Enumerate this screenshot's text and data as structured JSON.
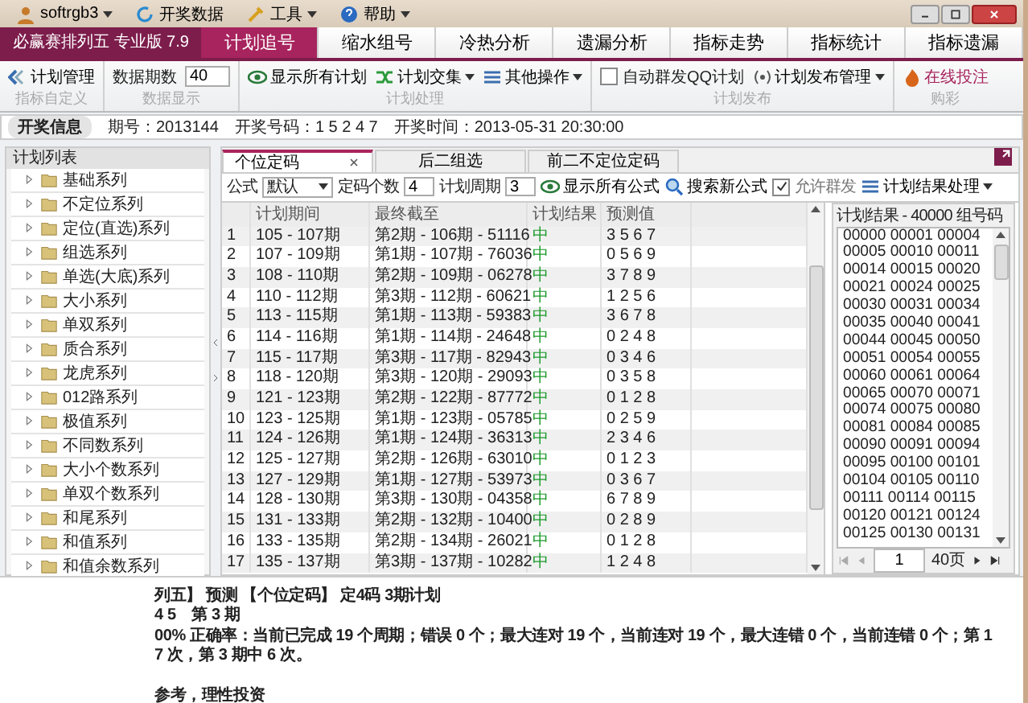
{
  "menu": [
    {
      "label": "softrgb3",
      "dropdown": true
    },
    {
      "label": "开奖数据",
      "dropdown": false
    },
    {
      "label": "工具",
      "dropdown": true
    },
    {
      "label": "帮助",
      "dropdown": true
    }
  ],
  "app_tab": "必赢赛排列五 专业版 7.9",
  "tabs": [
    {
      "label": "计划追号",
      "selected": true
    },
    {
      "label": "缩水组号",
      "selected": false
    },
    {
      "label": "冷热分析",
      "selected": false
    },
    {
      "label": "遗漏分析",
      "selected": false
    },
    {
      "label": "指标走势",
      "selected": false
    },
    {
      "label": "指标统计",
      "selected": false
    },
    {
      "label": "指标遗漏",
      "selected": false
    }
  ],
  "ribbon": [
    {
      "label": "指标自定义",
      "items": [
        {
          "kind": "button",
          "label": "计划管理"
        }
      ]
    },
    {
      "label": "数据显示",
      "items": [
        {
          "kind": "field",
          "label": "数据期数",
          "value": "40"
        }
      ]
    },
    {
      "label": "计划处理",
      "items": [
        {
          "kind": "button",
          "label": "显示所有计划"
        },
        {
          "kind": "dropdown",
          "label": "计划交集"
        },
        {
          "kind": "dropdown",
          "label": "其他操作"
        }
      ]
    },
    {
      "label": "计划发布",
      "items": [
        {
          "kind": "checkbox",
          "label": "自动群发QQ计划",
          "checked": false
        },
        {
          "kind": "dropdown",
          "label": "计划发布管理"
        }
      ]
    },
    {
      "label": "购彩",
      "items": [
        {
          "kind": "link",
          "label": "在线投注"
        }
      ]
    }
  ],
  "draw_info": {
    "title": "开奖信息",
    "issue": "期号：2013144",
    "numbers": "开奖号码：1 5 2 4 7",
    "time": "开奖时间：2013-05-31 20:30:00"
  },
  "sidebar": {
    "title": "计划列表",
    "items": [
      "基础系列",
      "不定位系列",
      "定位(直选)系列",
      "组选系列",
      "单选(大底)系列",
      "大小系列",
      "单双系列",
      "质合系列",
      "龙虎系列",
      "012路系列",
      "极值系列",
      "不同数系列",
      "大小个数系列",
      "单双个数系列",
      "和尾系列",
      "和值系列",
      "和值余数系列"
    ]
  },
  "doc_tabs": [
    {
      "label": "个位定码",
      "selected": true,
      "closable": true
    },
    {
      "label": "后二组选",
      "selected": false,
      "closable": false
    },
    {
      "label": "前二不定位定码",
      "selected": false,
      "closable": false
    }
  ],
  "toolbar": {
    "formula_label": "公式",
    "formula_value": "默认",
    "count_label": "定码个数",
    "count_value": "4",
    "period_label": "计划周期",
    "period_value": "3",
    "show_all": "显示所有公式",
    "search": "搜索新公式",
    "allow_group": {
      "label": "允许群发",
      "checked": true
    },
    "process": "计划结果处理"
  },
  "table": {
    "columns": [
      "计划期间",
      "最终截至",
      "计划结果",
      "预测值"
    ],
    "rows": [
      {
        "n": "1",
        "period": "105 - 107期",
        "end": "第2期 - 106期 - 51116",
        "result": "中",
        "pred": "3 5 6 7"
      },
      {
        "n": "2",
        "period": "107 - 109期",
        "end": "第1期 - 107期 - 76036",
        "result": "中",
        "pred": "0 5 6 9"
      },
      {
        "n": "3",
        "period": "108 - 110期",
        "end": "第2期 - 109期 - 06278",
        "result": "中",
        "pred": "3 7 8 9"
      },
      {
        "n": "4",
        "period": "110 - 112期",
        "end": "第3期 - 112期 - 60621",
        "result": "中",
        "pred": "1 2 5 6"
      },
      {
        "n": "5",
        "period": "113 - 115期",
        "end": "第1期 - 113期 - 59383",
        "result": "中",
        "pred": "3 6 7 8"
      },
      {
        "n": "6",
        "period": "114 - 116期",
        "end": "第1期 - 114期 - 24648",
        "result": "中",
        "pred": "0 2 4 8"
      },
      {
        "n": "7",
        "period": "115 - 117期",
        "end": "第3期 - 117期 - 82943",
        "result": "中",
        "pred": "0 3 4 6"
      },
      {
        "n": "8",
        "period": "118 - 120期",
        "end": "第3期 - 120期 - 29093",
        "result": "中",
        "pred": "0 3 5 8"
      },
      {
        "n": "9",
        "period": "121 - 123期",
        "end": "第2期 - 122期 - 87772",
        "result": "中",
        "pred": "0 1 2 8"
      },
      {
        "n": "10",
        "period": "123 - 125期",
        "end": "第1期 - 123期 - 05785",
        "result": "中",
        "pred": "0 2 5 9"
      },
      {
        "n": "11",
        "period": "124 - 126期",
        "end": "第1期 - 124期 - 36313",
        "result": "中",
        "pred": "2 3 4 6"
      },
      {
        "n": "12",
        "period": "125 - 127期",
        "end": "第2期 - 126期 - 63010",
        "result": "中",
        "pred": "0 1 2 3"
      },
      {
        "n": "13",
        "period": "127 - 129期",
        "end": "第1期 - 127期 - 53973",
        "result": "中",
        "pred": "0 3 6 7"
      },
      {
        "n": "14",
        "period": "128 - 130期",
        "end": "第3期 - 130期 - 04358",
        "result": "中",
        "pred": "6 7 8 9"
      },
      {
        "n": "15",
        "period": "131 - 133期",
        "end": "第2期 - 132期 - 10400",
        "result": "中",
        "pred": "0 2 8 9"
      },
      {
        "n": "16",
        "period": "133 - 135期",
        "end": "第2期 - 134期 - 26021",
        "result": "中",
        "pred": "0 1 2 8"
      },
      {
        "n": "17",
        "period": "135 - 137期",
        "end": "第3期 - 137期 - 10282",
        "result": "中",
        "pred": "1 2 4 8"
      }
    ]
  },
  "results": {
    "title": "计划结果  - 40000 组号码",
    "lines": [
      "00000 00001 00004",
      "00005 00010 00011",
      "00014 00015 00020",
      "00021 00024 00025",
      "00030 00031 00034",
      "00035 00040 00041",
      "00044 00045 00050",
      "00051 00054 00055",
      "00060 00061 00064",
      "00065 00070 00071",
      "00074 00075 00080",
      "00081 00084 00085",
      "00090 00091 00094",
      "00095 00100 00101",
      "00104 00105 00110",
      "00111 00114 00115",
      "00120 00121 00124",
      "00125 00130 00131"
    ],
    "page": "1",
    "pages": "40页"
  },
  "summary": [
    "列五】 预测 【个位定码】 定4码 3期计划",
    "4 5　第 3 期",
    "00% 正确率：当前已完成 19 个周期；错误 0 个；最大连对 19 个，当前连对 19 个，最大连错 0 个，当前连错 0 个；第 1",
    "7 次，第 3 期中 6 次。",
    "参考，理性投资"
  ]
}
